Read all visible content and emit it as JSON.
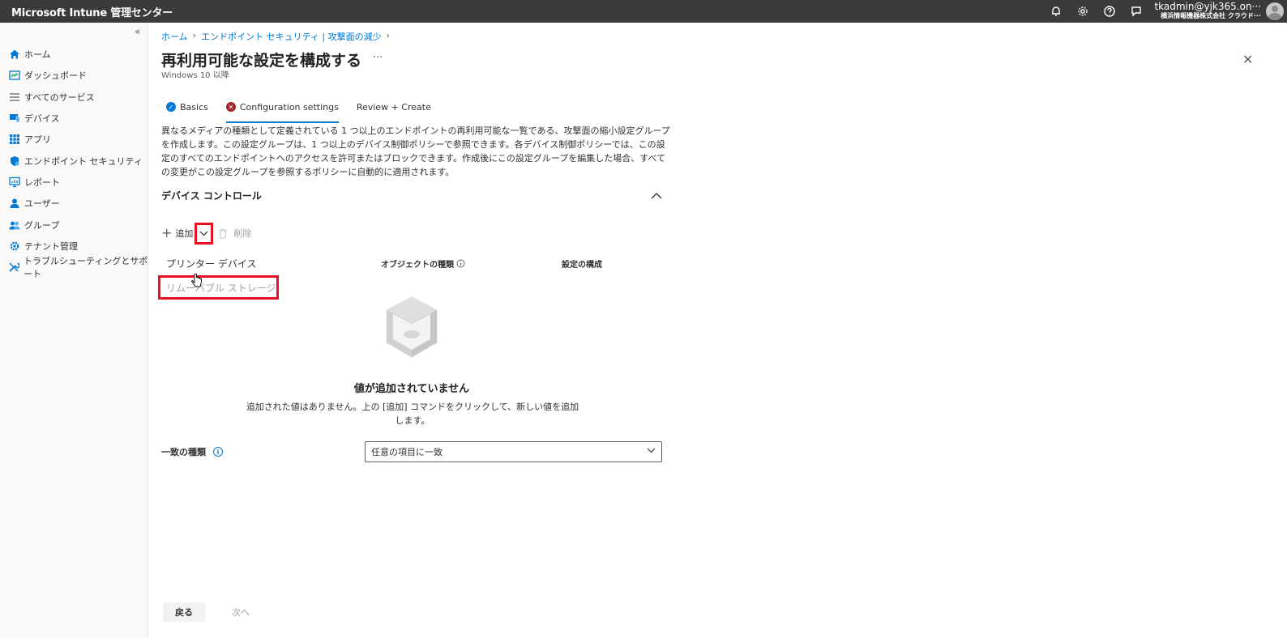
{
  "app": {
    "brand": "Microsoft Intune 管理センター"
  },
  "account": {
    "user": "tkadmin@yjk365.on···",
    "tenant": "横浜情報機器株式会社 クラウド···"
  },
  "sidebar": {
    "collapse_glyph": "«",
    "items": [
      {
        "label": "ホーム",
        "icon": "home-icon"
      },
      {
        "label": "ダッシュボード",
        "icon": "dashboard-icon"
      },
      {
        "label": "すべてのサービス",
        "icon": "list-icon"
      },
      {
        "label": "デバイス",
        "icon": "devices-icon"
      },
      {
        "label": "アプリ",
        "icon": "apps-icon"
      },
      {
        "label": "エンドポイント セキュリティ",
        "icon": "shield-icon"
      },
      {
        "label": "レポート",
        "icon": "report-icon"
      },
      {
        "label": "ユーザー",
        "icon": "user-icon"
      },
      {
        "label": "グループ",
        "icon": "group-icon"
      },
      {
        "label": "テナント管理",
        "icon": "tenant-icon"
      },
      {
        "label": "トラブルシューティングとサポート",
        "icon": "wrench-icon"
      }
    ]
  },
  "breadcrumb": [
    "ホーム",
    "エンドポイント セキュリティ | 攻撃面の減少"
  ],
  "page": {
    "title": "再利用可能な設定を構成する",
    "more": "···",
    "subtitle": "Windows 10 以降",
    "close": "✕"
  },
  "tabs": [
    {
      "label": "Basics",
      "state": "done"
    },
    {
      "label": "Configuration settings",
      "state": "error"
    },
    {
      "label": "Review + Create",
      "state": "none"
    }
  ],
  "description": "異なるメディアの種類として定義されている 1 つ以上のエンドポイントの再利用可能な一覧である、攻撃面の縮小設定グループを作成します。この設定グループは、1 つ以上のデバイス制御ポリシーで参照できます。各デバイス制御ポリシーでは、この設定のすべてのエンドポイントへのアクセスを許可またはブロックできます。作成後にこの設定グループを編集した場合、すべての変更がこの設定グループを参照するポリシーに自動的に適用されます。",
  "section": {
    "title": "デバイス コントロール"
  },
  "toolbar": {
    "add": "追加",
    "delete": "削除"
  },
  "dropdown": {
    "items": [
      "プリンター デバイス",
      "リムーバブル ストレージ"
    ]
  },
  "columns": {
    "object_type": "オブジェクトの種類",
    "config": "設定の構成"
  },
  "empty": {
    "title": "値が追加されていません",
    "desc": "追加された値はありません。上の [追加] コマンドをクリックして、新しい値を追加します。"
  },
  "match": {
    "label": "一致の種類",
    "value": "任意の項目に一致"
  },
  "footer": {
    "back": "戻る",
    "next": "次へ"
  },
  "colors": {
    "accent": "#0078d4",
    "highlight": "#e81123",
    "topbar": "#3b3a39"
  }
}
